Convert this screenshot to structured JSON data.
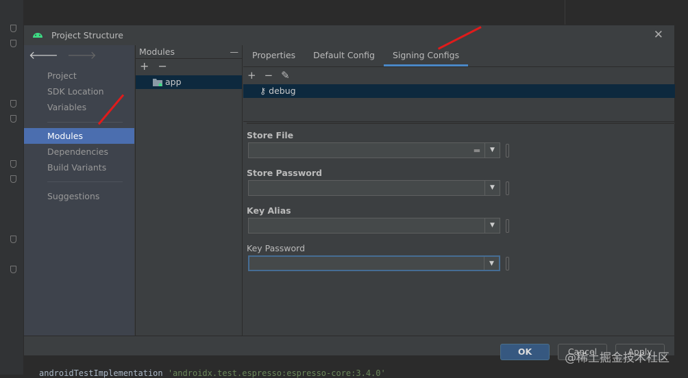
{
  "dialog": {
    "title": "Project Structure",
    "close_icon": "close-icon"
  },
  "nav": {
    "items": [
      "Project",
      "SDK Location",
      "Variables",
      "Modules",
      "Dependencies",
      "Build Variants",
      "Suggestions"
    ],
    "selected": "Modules"
  },
  "modules": {
    "header": "Modules",
    "items": [
      "app"
    ]
  },
  "tabs": [
    "Properties",
    "Default Config",
    "Signing Configs"
  ],
  "selected_tab": "Signing Configs",
  "signing_configs": [
    "debug"
  ],
  "form": {
    "store_file": "Store File",
    "store_password": "Store Password",
    "key_alias": "Key Alias",
    "key_password": "Key Password"
  },
  "buttons": {
    "ok": "OK",
    "cancel": "Cancel",
    "apply": "Apply"
  },
  "editor": {
    "code_kw": "androidTestImplementation ",
    "code_str": "'androidx.test.espresso:espresso-core:3.4.0'"
  },
  "watermark": "@稀土掘金技术社区",
  "colors": {
    "selection": "#4b6eaf",
    "tab_underline": "#4a88c7",
    "ok_button": "#365880",
    "annotation_arrow": "#e01b1b"
  }
}
